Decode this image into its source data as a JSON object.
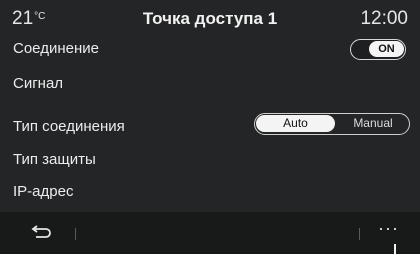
{
  "status": {
    "temperature": "21",
    "temperature_unit": "°C",
    "title": "Точка доступа 1",
    "time": "12:00"
  },
  "settings": {
    "connection": {
      "label": "Соединение",
      "toggle_state": "ON"
    },
    "signal": {
      "label": "Сигнал"
    },
    "connection_type": {
      "label": "Тип соединения",
      "options": [
        "Auto",
        "Manual"
      ],
      "selected": "Auto"
    },
    "security_type": {
      "label": "Тип защиты"
    },
    "ip_address": {
      "label": "IP-адрес"
    }
  },
  "bottom_bar": {
    "back_icon": "back-arrow-icon",
    "more_label": "···"
  }
}
